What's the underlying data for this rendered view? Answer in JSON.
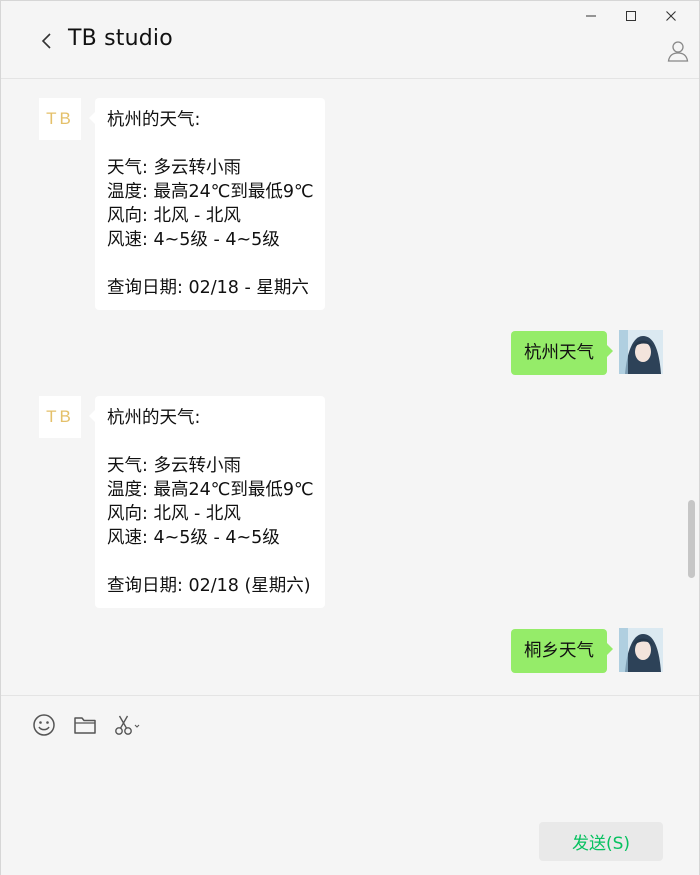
{
  "window": {
    "title": "TB studio",
    "controls": {
      "minimize": "—",
      "maximize": "☐",
      "close": "✕"
    }
  },
  "messages": [
    {
      "from": "bot",
      "avatar_text": "TB",
      "lines": [
        "杭州的天气:",
        "",
        "天气: 多云转小雨",
        "温度: 最高24℃到最低9℃",
        "风向: 北风 - 北风",
        "风速: 4~5级 - 4~5级",
        "",
        "查询日期: 02/18 - 星期六"
      ]
    },
    {
      "from": "user",
      "text": "杭州天气"
    },
    {
      "from": "bot",
      "avatar_text": "TB",
      "lines": [
        "杭州的天气:",
        "",
        "天气: 多云转小雨",
        "温度: 最高24℃到最低9℃",
        "风向: 北风 - 北风",
        "风速: 4~5级 - 4~5级",
        "",
        "查询日期: 02/18 (星期六)"
      ]
    },
    {
      "from": "user",
      "text": "桐乡天气"
    }
  ],
  "toolbar": {
    "emoji_icon": "emoji-icon",
    "folder_icon": "folder-icon",
    "scissors_icon": "scissors-icon"
  },
  "send_button": {
    "label": "发送(S)"
  },
  "colors": {
    "background": "#f5f5f5",
    "bubble_in": "#ffffff",
    "bubble_out": "#95ec69",
    "send_text": "#07c160",
    "bot_avatar_text": "#e4c06a"
  }
}
